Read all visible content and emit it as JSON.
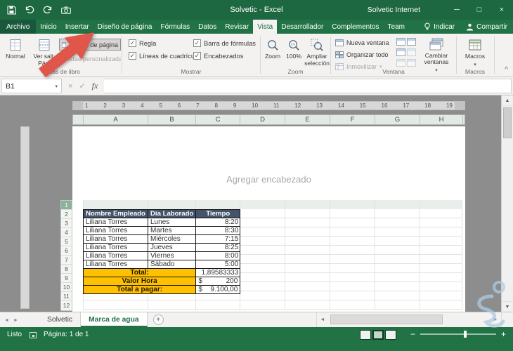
{
  "colors": {
    "excel_green": "#217346",
    "titlebar_green": "#1D6840",
    "table_header_blue": "#44546A",
    "summary_amber": "#FFC000",
    "arrow_red": "#E0564A"
  },
  "icons": {
    "caret_down": "▾",
    "check": "✓",
    "cancel": "×",
    "minimize": "─",
    "maximize": "□",
    "close": "×",
    "collapse_ribbon": "^",
    "scroll_up": "▲",
    "scroll_down": "▼",
    "scroll_left": "◄",
    "scroll_right": "►",
    "tab_prev": "◄",
    "tab_next": "►"
  },
  "titlebar": {
    "title": "Solvetic - Excel",
    "account": "Solvetic Internet"
  },
  "ribbon": {
    "tabs": [
      "Archivo",
      "Inicio",
      "Insertar",
      "Diseño de página",
      "Fórmulas",
      "Datos",
      "Revisar",
      "Vista",
      "Desarrollador",
      "Complementos",
      "Team"
    ],
    "active_tab": "Vista",
    "tell_me": "Indicar",
    "share": "Compartir",
    "groups": {
      "vistas": {
        "label": "Vistas de libro",
        "normal": "Normal",
        "salto": "Ver salt.\nPág.",
        "diseno": "Diseño de página",
        "personalizadas": "Vistas personalizadas"
      },
      "mostrar": {
        "label": "Mostrar",
        "regla": "Regla",
        "lineas": "Líneas de cuadrícula",
        "barra": "Barra de fórmulas",
        "encabezados": "Encabezados"
      },
      "zoom": {
        "label": "Zoom",
        "zoom": "Zoom",
        "pct": "100%",
        "ampliar": "Ampliar\nselección"
      },
      "ventana": {
        "label": "Ventana",
        "nueva": "Nueva ventana",
        "organizar": "Organizar todo",
        "inmovilizar": "Inmovilizar",
        "cambiar": "Cambiar\nventanas"
      },
      "macros": {
        "label": "Macros",
        "btn": "Macros"
      }
    }
  },
  "formula_bar": {
    "name_box": "B1",
    "cancel": "×",
    "enter": "✓",
    "fx": "fx",
    "value": ""
  },
  "worksheet": {
    "ruler": [
      "1",
      "2",
      "3",
      "4",
      "5",
      "6",
      "7",
      "8",
      "9",
      "10",
      "11",
      "12",
      "13",
      "14",
      "15",
      "16",
      "17",
      "18",
      "19"
    ],
    "columns": [
      "A",
      "B",
      "C",
      "D",
      "E",
      "F",
      "G",
      "H"
    ],
    "rows": [
      "1",
      "2",
      "3",
      "4",
      "5",
      "6",
      "7",
      "8",
      "9",
      "10",
      "11",
      "12"
    ],
    "header_placeholder": "Agregar encabezado",
    "table": {
      "headers": [
        "Nombre Empleado",
        "Día Laborado",
        "Tiempo"
      ],
      "data": [
        [
          "Liliana Torres",
          "Lunes",
          "8:20"
        ],
        [
          "Liliana Torres",
          "Martes",
          "8:30"
        ],
        [
          "Liliana Torres",
          "Miércoles",
          "7:15"
        ],
        [
          "Liliana Torres",
          "Jueves",
          "8:25"
        ],
        [
          "Liliana Torres",
          "Viernes",
          "8:00"
        ],
        [
          "Liliana Torres",
          "Sábado",
          "5:00"
        ]
      ],
      "summary": {
        "total_label": "Total:",
        "total_value": "1,89583333",
        "valor_label": "Valor Hora",
        "valor_currency": "$",
        "valor_value": "200",
        "pagar_label": "Total a pagar:",
        "pagar_currency": "$",
        "pagar_value": "9.100,00"
      }
    }
  },
  "sheet_tabs": {
    "tabs": [
      "Solvetic",
      "Marca de agua"
    ],
    "active": "Marca de agua",
    "add_label": "+"
  },
  "status_bar": {
    "ready": "Listo",
    "page": "Página: 1 de 1",
    "zoom_out": "−",
    "zoom_in": "+"
  }
}
